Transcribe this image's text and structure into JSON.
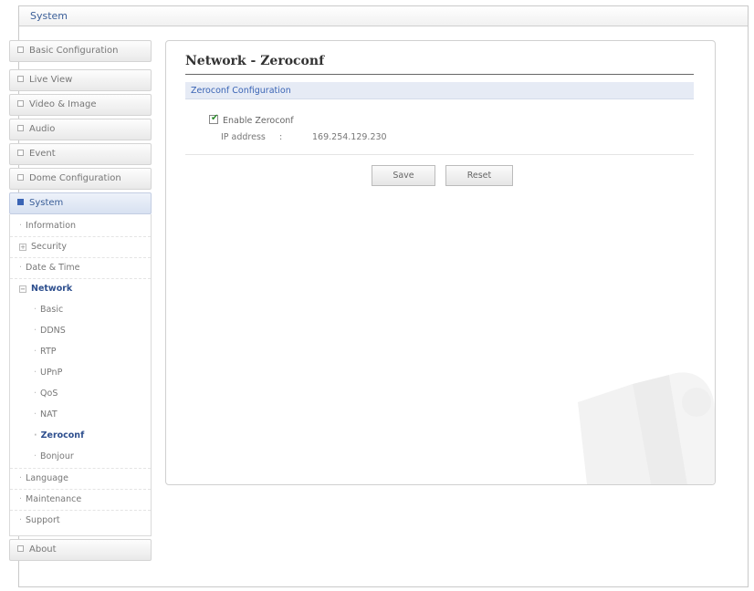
{
  "window": {
    "title": "System"
  },
  "sidebar": {
    "basic_configuration": "Basic Configuration",
    "live_view": "Live View",
    "video_image": "Video & Image",
    "audio": "Audio",
    "event": "Event",
    "dome_configuration": "Dome Configuration",
    "system": "System",
    "system_items": {
      "information": "Information",
      "security": "Security",
      "date_time": "Date & Time",
      "network": "Network",
      "network_items": [
        "Basic",
        "DDNS",
        "RTP",
        "UPnP",
        "QoS",
        "NAT",
        "Zeroconf",
        "Bonjour"
      ],
      "language": "Language",
      "maintenance": "Maintenance",
      "support": "Support"
    },
    "about": "About"
  },
  "main": {
    "page_title": "Network - Zeroconf",
    "section_title": "Zeroconf Configuration",
    "enable_label": "Enable Zeroconf",
    "enable_checked": true,
    "ip_label": "IP address",
    "ip_sep": ":",
    "ip_value": "169.254.129.230",
    "save_label": "Save",
    "reset_label": "Reset"
  },
  "colors": {
    "accent": "#3a64b5",
    "section_bar": "#e6ebf5",
    "check": "#2a8a2a"
  }
}
